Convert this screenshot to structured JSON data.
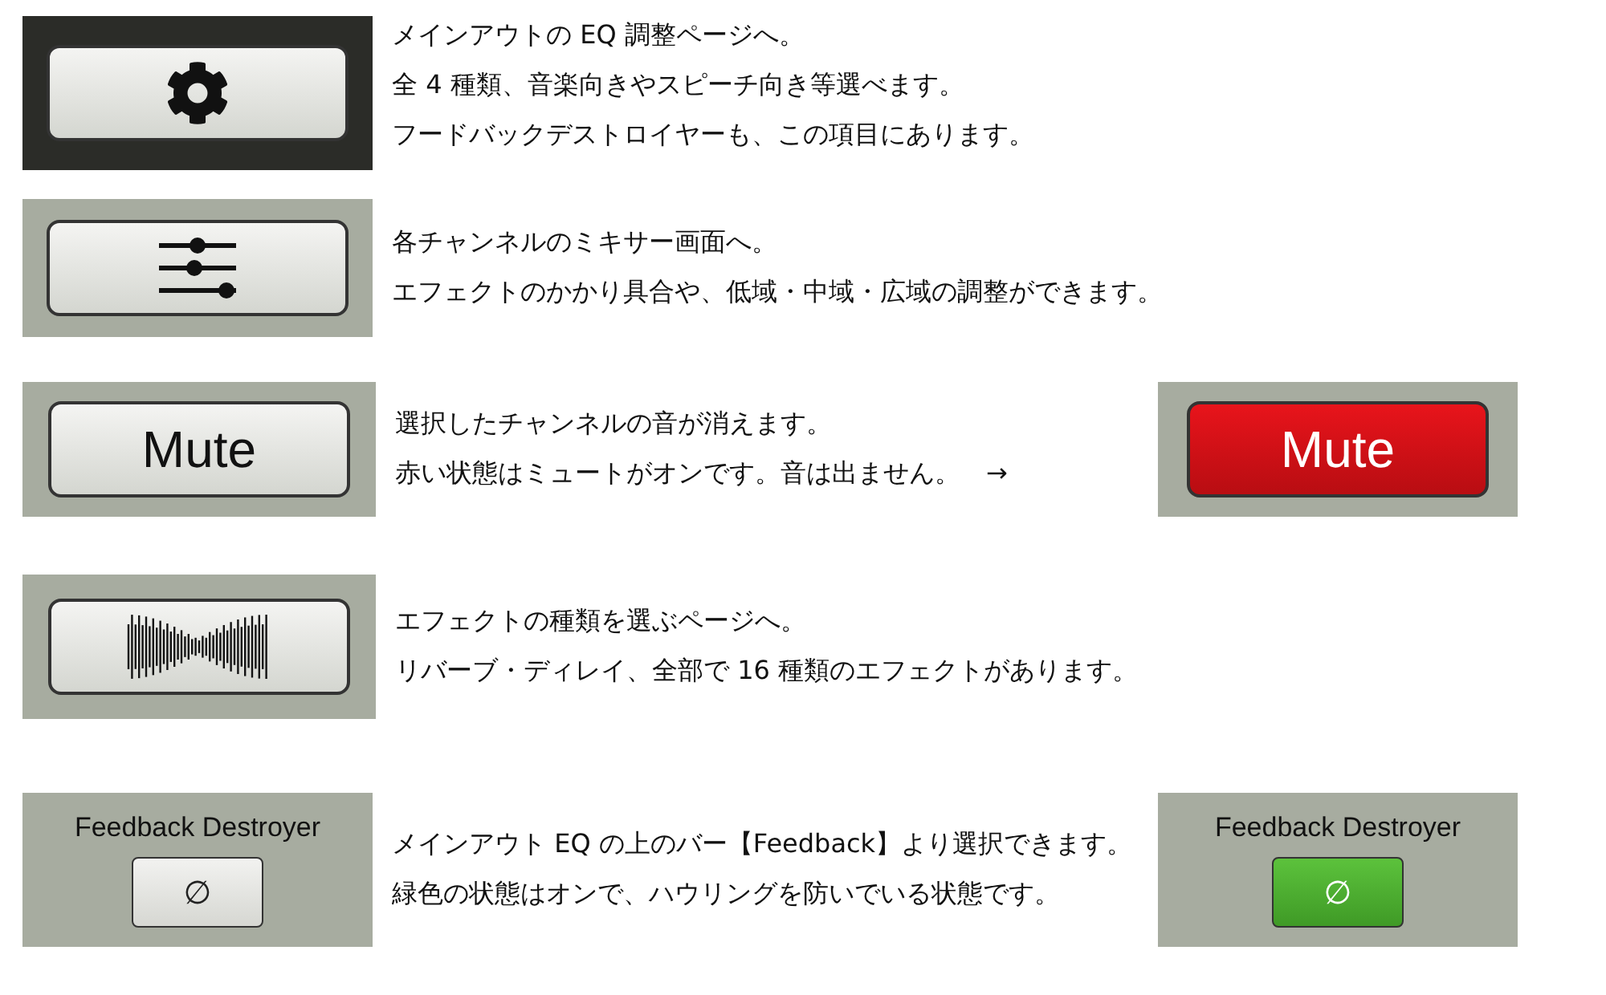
{
  "sections": [
    {
      "kind": "gear",
      "lines": [
        "メインアウトの EQ 調整ページへ。",
        "全 4 種類、音楽向きやスピーチ向き等選べます。",
        "フードバックデストロイヤーも、この項目にあります。"
      ]
    },
    {
      "kind": "sliders",
      "lines": [
        "各チャンネルのミキサー画面へ。",
        "エフェクトのかかり具合や、低域・中域・広域の調整ができます。"
      ]
    },
    {
      "kind": "mute",
      "button": {
        "label": "Mute",
        "on": false
      },
      "lines": [
        "選択したチャンネルの音が消えます。",
        "赤い状態はミュートがオンです。音は出ません。　→"
      ],
      "result": {
        "label": "Mute",
        "on": true
      }
    },
    {
      "kind": "wave",
      "lines": [
        "エフェクトの種類を選ぶページへ。",
        "リバーブ・ディレイ、全部で 16 種類のエフェクトがあります。"
      ]
    },
    {
      "kind": "feedback",
      "button": {
        "title": "Feedback Destroyer",
        "label": "∅",
        "on": false
      },
      "lines": [
        "メインアウト EQ の上のバー【Feedback】より選択できます。",
        "緑色の状態はオンで、ハウリングを防いでいる状態です。"
      ],
      "result": {
        "title": "Feedback Destroyer",
        "label": "∅",
        "on": true
      }
    }
  ]
}
